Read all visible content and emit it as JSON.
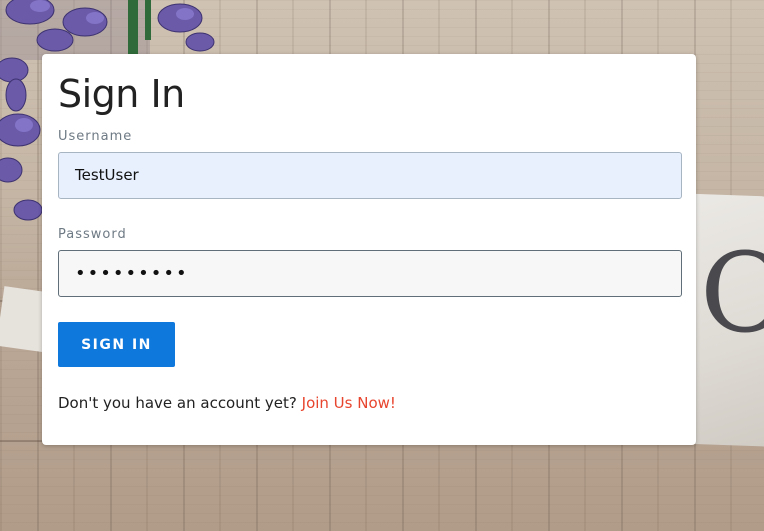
{
  "form": {
    "title": "Sign In",
    "username_label": "Username",
    "username_value": "TestUser",
    "password_label": "Password",
    "password_value": "•••••••••",
    "submit_label": "SIGN IN",
    "signup_prompt": "Don't you have an account yet?",
    "signup_link": "Join Us Now!"
  },
  "background": {
    "board_letter": "O"
  },
  "colors": {
    "accent": "#0f78dc",
    "link": "#e8452e",
    "username_field_bg": "#e8f0fe"
  }
}
